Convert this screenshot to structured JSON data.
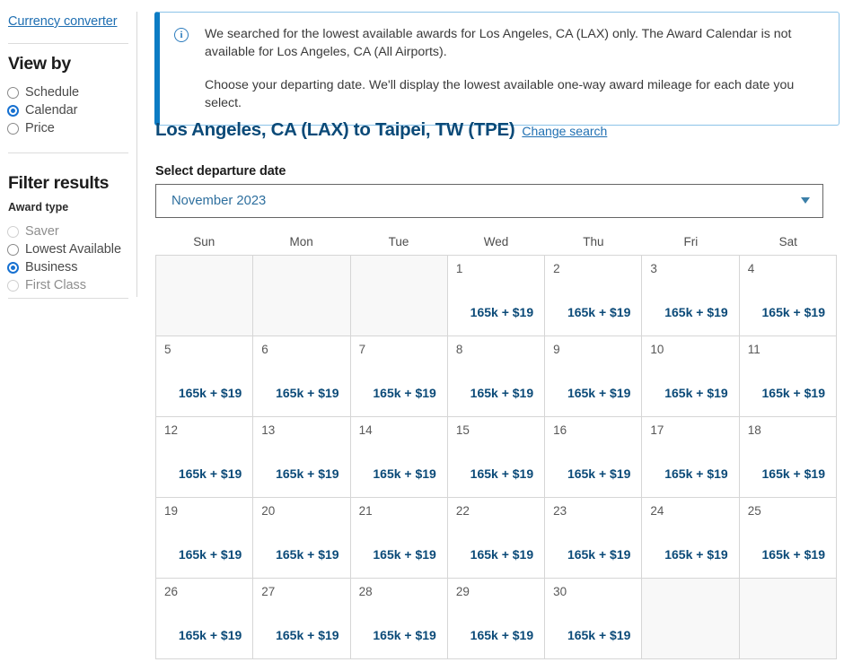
{
  "sidebar": {
    "currency_link": "Currency converter",
    "view_by": {
      "title": "View by",
      "options": [
        {
          "label": "Schedule",
          "selected": false,
          "disabled": false
        },
        {
          "label": "Calendar",
          "selected": true,
          "disabled": false
        },
        {
          "label": "Price",
          "selected": false,
          "disabled": false
        }
      ]
    },
    "filter_results": {
      "title": "Filter results",
      "award_type_label": "Award type",
      "options": [
        {
          "label": "Saver",
          "selected": false,
          "disabled": true
        },
        {
          "label": "Lowest Available",
          "selected": false,
          "disabled": false
        },
        {
          "label": "Business",
          "selected": true,
          "disabled": false
        },
        {
          "label": "First Class",
          "selected": false,
          "disabled": true
        }
      ]
    }
  },
  "banner": {
    "icon": "info-circle-icon",
    "accent_color": "#0c7cc4",
    "border_color": "#8cc3e8",
    "paragraph_1": "We searched for the lowest available awards for Los Angeles, CA (LAX) only. The Award Calendar is not available for Los Angeles, CA (All Airports).",
    "paragraph_2": "Choose your departing date. We'll display the lowest available one-way award mileage for each date you select."
  },
  "route": {
    "title": "Los Angeles, CA (LAX) to Taipei, TW (TPE)",
    "change_search_label": "Change search",
    "title_color": "#0b4a78"
  },
  "departure": {
    "label": "Select departure date",
    "selected_month": "November 2023",
    "options": [
      "November 2023"
    ],
    "chevron_icon": "chevron-down-icon"
  },
  "calendar": {
    "day_headers": [
      "Sun",
      "Mon",
      "Tue",
      "Wed",
      "Thu",
      "Fri",
      "Sat"
    ],
    "price_color": "#0b4a78",
    "weeks": [
      [
        {
          "date": "",
          "price": ""
        },
        {
          "date": "",
          "price": ""
        },
        {
          "date": "",
          "price": ""
        },
        {
          "date": "1",
          "price": "165k + $19"
        },
        {
          "date": "2",
          "price": "165k + $19"
        },
        {
          "date": "3",
          "price": "165k + $19"
        },
        {
          "date": "4",
          "price": "165k + $19"
        }
      ],
      [
        {
          "date": "5",
          "price": "165k + $19"
        },
        {
          "date": "6",
          "price": "165k + $19"
        },
        {
          "date": "7",
          "price": "165k + $19"
        },
        {
          "date": "8",
          "price": "165k + $19"
        },
        {
          "date": "9",
          "price": "165k + $19"
        },
        {
          "date": "10",
          "price": "165k + $19"
        },
        {
          "date": "11",
          "price": "165k + $19"
        }
      ],
      [
        {
          "date": "12",
          "price": "165k + $19"
        },
        {
          "date": "13",
          "price": "165k + $19"
        },
        {
          "date": "14",
          "price": "165k + $19"
        },
        {
          "date": "15",
          "price": "165k + $19"
        },
        {
          "date": "16",
          "price": "165k + $19"
        },
        {
          "date": "17",
          "price": "165k + $19"
        },
        {
          "date": "18",
          "price": "165k + $19"
        }
      ],
      [
        {
          "date": "19",
          "price": "165k + $19"
        },
        {
          "date": "20",
          "price": "165k + $19"
        },
        {
          "date": "21",
          "price": "165k + $19"
        },
        {
          "date": "22",
          "price": "165k + $19"
        },
        {
          "date": "23",
          "price": "165k + $19"
        },
        {
          "date": "24",
          "price": "165k + $19"
        },
        {
          "date": "25",
          "price": "165k + $19"
        }
      ],
      [
        {
          "date": "26",
          "price": "165k + $19"
        },
        {
          "date": "27",
          "price": "165k + $19"
        },
        {
          "date": "28",
          "price": "165k + $19"
        },
        {
          "date": "29",
          "price": "165k + $19"
        },
        {
          "date": "30",
          "price": "165k + $19"
        },
        {
          "date": "",
          "price": ""
        },
        {
          "date": "",
          "price": ""
        }
      ]
    ]
  }
}
